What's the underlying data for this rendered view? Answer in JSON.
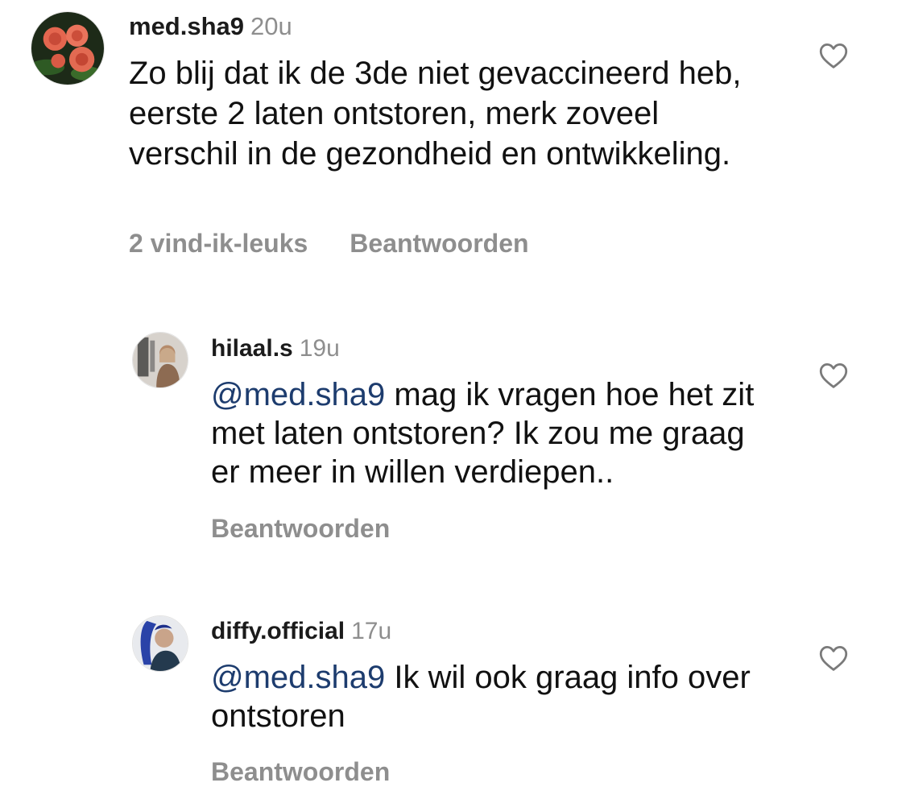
{
  "comments": [
    {
      "username": "med.sha9",
      "time": "20u",
      "text": "Zo blij dat ik de 3de niet gevaccineerd heb, eerste 2 laten ontstoren, merk zoveel verschil in de gezondheid en ontwikkeling.",
      "likes": "2 vind-ik-leuks",
      "reply_label": "Beantwoorden",
      "heart_icon": "heart-outline-icon"
    }
  ],
  "replies": [
    {
      "username": "hilaal.s",
      "time": "19u",
      "mention": "@med.sha9",
      "text": " mag ik vragen hoe het zit met laten ontstoren? Ik zou me graag er meer in willen verdiepen..",
      "reply_label": "Beantwoorden",
      "heart_icon": "heart-outline-icon"
    },
    {
      "username": "diffy.official",
      "time": "17u",
      "mention": "@med.sha9",
      "text": " Ik wil ook graag info over ontstoren",
      "reply_label": "Beantwoorden",
      "heart_icon": "heart-outline-icon"
    }
  ],
  "colors": {
    "mention": "#1d3c6e",
    "muted": "#8e8e8e",
    "text": "#111111"
  }
}
